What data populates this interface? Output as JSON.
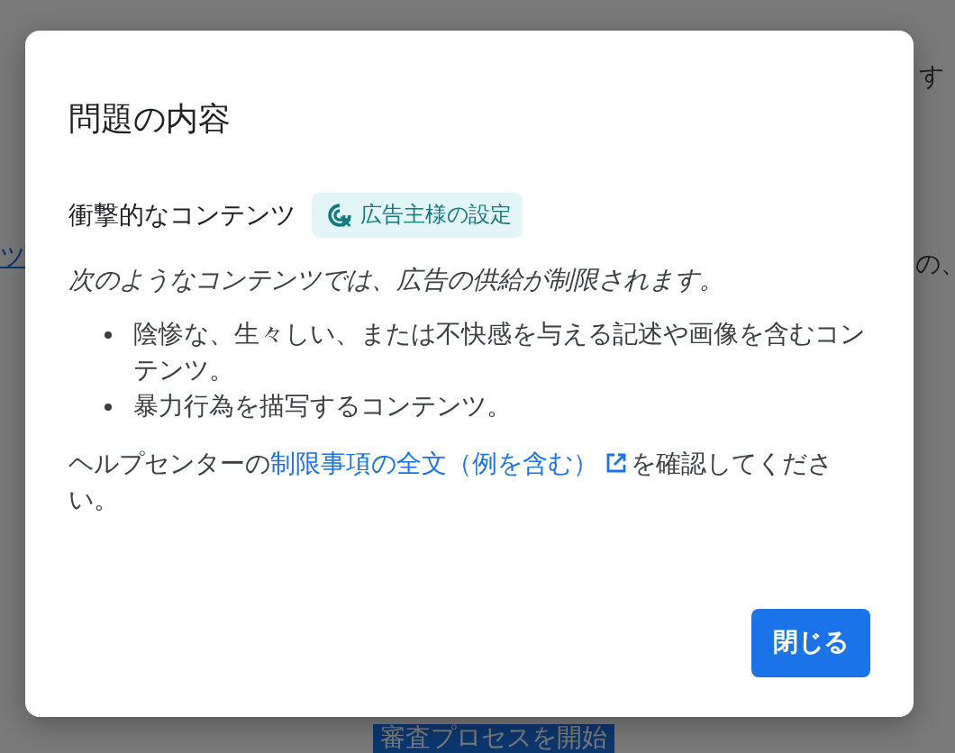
{
  "background_page": {
    "left_link": "ツ",
    "right_fragments": [
      "す",
      "の、"
    ],
    "start_button": "審査プロセスを開始"
  },
  "dialog": {
    "title": "問題の内容",
    "issue": {
      "heading": "衝撃的なコンテンツ",
      "chip": "広告主様の設定"
    },
    "intro": "次のようなコンテンツでは、広告の供給が制限されます。",
    "bullets": [
      "陰惨な、生々しい、または不快感を与える記述や画像を含むコンテンツ。",
      "暴力行為を描写するコンテンツ。"
    ],
    "help": {
      "before": "ヘルプセンターの",
      "link": "制限事項の全文（例を含む）",
      "after": "を確認してください。"
    },
    "buttons": [
      "閉じる"
    ]
  }
}
